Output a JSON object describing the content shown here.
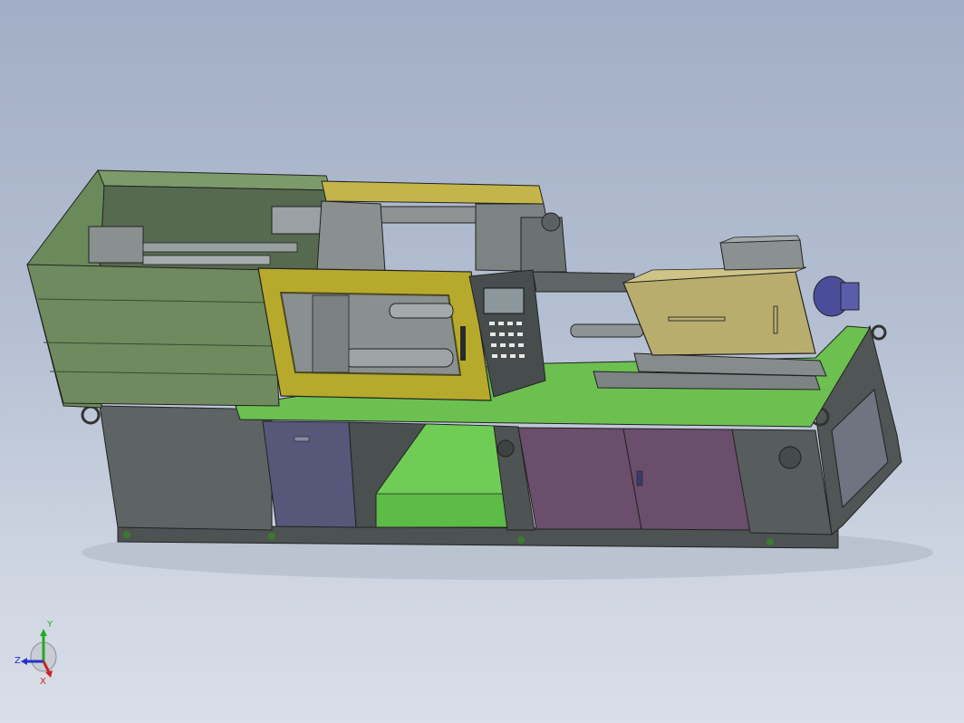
{
  "viewport": {
    "background_top": "#a2aec5",
    "background_bottom": "#d9dee8"
  },
  "model": {
    "name": "",
    "colors": {
      "base_green": "#6cc050",
      "cabinet_grey": "#5b6060",
      "frame_olive": "#6f8a5e",
      "guard_yellow": "#bfb02e",
      "panel_purple": "#6c4f6c",
      "door_blue": "#56567a",
      "motor_blue": "#4a4e9a",
      "hopper_khaki": "#b9ad6e",
      "controller_dark": "#3e4444"
    }
  },
  "triad": {
    "y_label": "Y",
    "z_label": "Z",
    "x_label": "X",
    "y_color": "#22aa22",
    "z_color": "#2233cc",
    "x_color": "#cc2222"
  }
}
